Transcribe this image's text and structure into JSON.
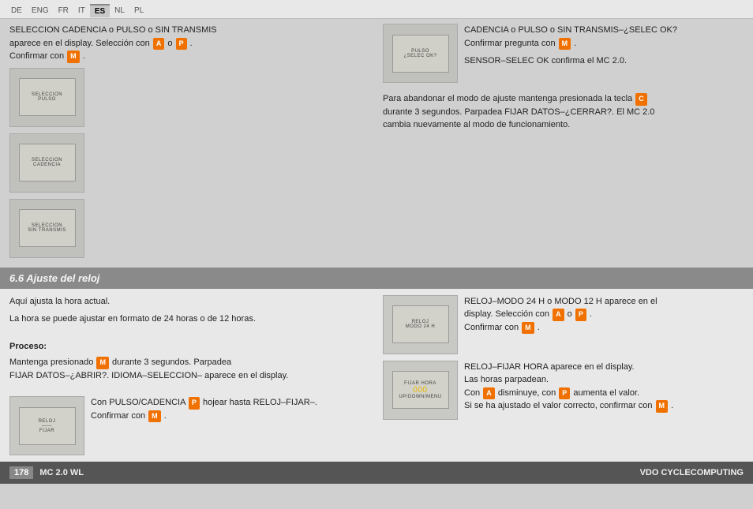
{
  "langs": [
    {
      "code": "DE",
      "active": false
    },
    {
      "code": "ENG",
      "active": false
    },
    {
      "code": "FR",
      "active": false
    },
    {
      "code": "IT",
      "active": false
    },
    {
      "code": "ES",
      "active": true
    },
    {
      "code": "NL",
      "active": false
    },
    {
      "code": "PL",
      "active": false
    }
  ],
  "upper_left": {
    "text1": "SELECCION CADENCIA o PULSO o SIN TRANSMIS",
    "text2": "aparece en el display. Selección con",
    "btn_a": "A",
    "text3": "o",
    "btn_p": "P",
    "text4": ".",
    "text5": "Confirmar con",
    "btn_m": "M",
    "text6": ".",
    "screens": [
      {
        "line1": "SELECCION",
        "line2": "PULSO"
      },
      {
        "line1": "SELECCION",
        "line2": "CADENCIA"
      },
      {
        "line1": "SELECCION",
        "line2": "SIN TRANSMIS"
      }
    ]
  },
  "upper_right": {
    "text1": "CADENCIA o PULSO o SIN TRANSMIS–¿SELEC OK?",
    "text2": "Confirmar pregunta con",
    "btn_m": "M",
    "text3": ".",
    "text4": "SENSOR–SELEC OK confirma el MC 2.0.",
    "abandon_text": "Para abandonar el modo de ajuste mantenga presionada la tecla",
    "btn_c": "C",
    "abandon_text2": "durante 3 segundos. Parpadea FIJAR DATOS–¿CERRAR?. El MC 2.0",
    "abandon_text3": "cambia nuevamente al modo de funcionamiento.",
    "screen": {
      "line1": "PULSO",
      "line2": "¿SELEC OK?"
    }
  },
  "section_header": "6.6 Ajuste del reloj",
  "lower_left": {
    "intro1": "Aquí ajusta la hora actual.",
    "intro2": "La hora se puede ajustar en formato de 24 horas o de 12 horas.",
    "proceso_label": "Proceso:",
    "proceso_text1": "Mantenga presionado",
    "btn_m": "M",
    "proceso_text2": "durante 3 segundos. Parpadea",
    "proceso_text3": "FIJAR DATOS–¿ABRIR?. IDIOMA–SELECCION– aparece en el display.",
    "pulso_text1": "Con PULSO/CADENCIA",
    "btn_p": "P",
    "pulso_text2": "hojear hasta RELOJ–FIJAR–.",
    "confirmar_text1": "Confirmar con",
    "btn_m2": "M",
    "confirmar_text2": ".",
    "screen": {
      "line1": "RELOJ",
      "line2": "—",
      "line3": "FIJAR"
    }
  },
  "lower_right": {
    "entry1": {
      "text1": "RELOJ–MODO 24 H o MODO 12 H aparece en el",
      "text2": "display. Selección con",
      "btn_a": "A",
      "text3": "o",
      "btn_p": "P",
      "text4": ".",
      "text5": "Confirmar con",
      "btn_m": "M",
      "text6": ".",
      "screen": {
        "line1": "RELOJ",
        "line2": "MODO 24 H"
      }
    },
    "entry2": {
      "text1": "RELOJ–FIJAR HORA aparece en el display.",
      "text2": "Las horas parpadean.",
      "text3": "Con",
      "btn_a": "A",
      "text4": "disminuye, con",
      "btn_p": "P",
      "text5": "aumenta el valor.",
      "text6": "Si se ha ajustado el valor correcto, confirmar con",
      "btn_m": "M",
      "text7": ".",
      "screen": {
        "line1": "FIJAR HORA",
        "line2": "000",
        "line3": "UP/DOWN/MENU"
      }
    }
  },
  "footer": {
    "page": "178",
    "model": "MC 2.0 WL",
    "brand": "VDO CYCLECOMPUTING"
  }
}
